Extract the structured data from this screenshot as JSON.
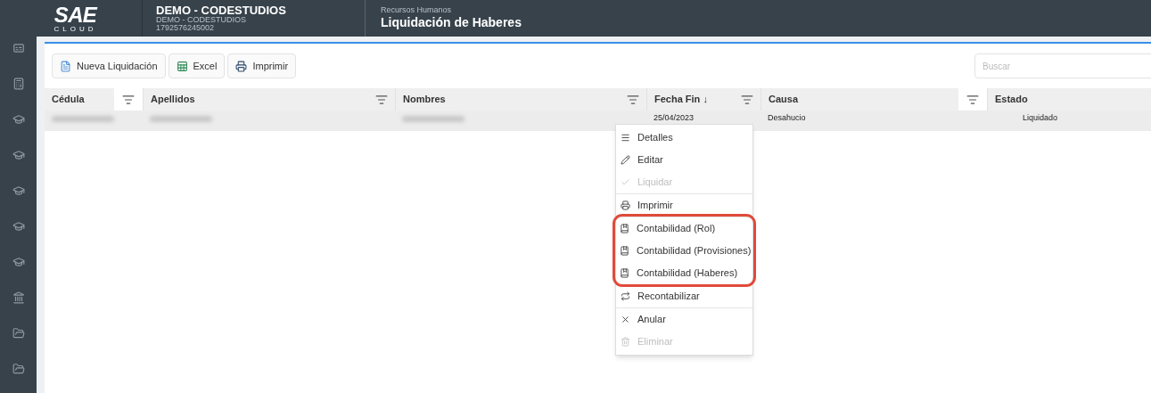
{
  "logo": {
    "mark": "SAE",
    "sub": "CLOUD"
  },
  "company": {
    "name": "DEMO - CODESTUDIOS",
    "subtitle": "DEMO - CODESTUDIOS",
    "ruc": "1792576245002"
  },
  "breadcrumb": {
    "module": "Recursos Humanos",
    "title": "Liquidación de Haberes"
  },
  "sidebar": {
    "items": [
      {
        "kind": "cc"
      },
      {
        "kind": "calculator"
      },
      {
        "kind": "school"
      },
      {
        "kind": "school"
      },
      {
        "kind": "school"
      },
      {
        "kind": "school"
      },
      {
        "kind": "school"
      },
      {
        "kind": "bank"
      },
      {
        "kind": "folder"
      },
      {
        "kind": "folder"
      }
    ]
  },
  "toolbar": [
    {
      "kind": "new",
      "label": "Nueva Liquidación"
    },
    {
      "kind": "excel",
      "label": "Excel"
    },
    {
      "kind": "print",
      "label": "Imprimir"
    }
  ],
  "search": {
    "placeholder": "Buscar"
  },
  "table": {
    "columns": [
      {
        "label": "Cédula",
        "kind": "button"
      },
      {
        "label": "Apellidos",
        "kind": "icon"
      },
      {
        "label": "Nombres",
        "kind": "icon"
      },
      {
        "label": "Fecha Fin ↓",
        "kind": "icon"
      },
      {
        "label": "Causa",
        "kind": "button"
      },
      {
        "label": "Estado",
        "kind": "plain"
      }
    ],
    "rows": [
      {
        "cells": [
          {
            "kind": "blurred"
          },
          {
            "kind": "blurred"
          },
          {
            "kind": "blurred"
          },
          {
            "kind": "text",
            "text": "25/04/2023"
          },
          {
            "kind": "text",
            "text": "Desahucio"
          },
          {
            "kind": "text",
            "text": "Liquidado"
          }
        ]
      }
    ]
  },
  "context_menu": {
    "sections": [
      {
        "highlighted": false,
        "items": [
          {
            "kind": "list",
            "label": "Detalles",
            "disabled": false
          },
          {
            "kind": "pencil",
            "label": "Editar",
            "disabled": false
          },
          {
            "kind": "check",
            "label": "Liquidar",
            "disabled": true
          }
        ]
      },
      {
        "highlighted": false,
        "items": [
          {
            "kind": "print",
            "label": "Imprimir",
            "disabled": false
          }
        ]
      },
      {
        "highlighted": true,
        "items": [
          {
            "kind": "book",
            "label": "Contabilidad (Rol)",
            "disabled": false
          },
          {
            "kind": "book",
            "label": "Contabilidad (Provisiones)",
            "disabled": false
          },
          {
            "kind": "book",
            "label": "Contabilidad (Haberes)",
            "disabled": false
          }
        ]
      },
      {
        "highlighted": false,
        "items": [
          {
            "kind": "repeat",
            "label": "Recontabilizar",
            "disabled": false
          }
        ]
      },
      {
        "highlighted": false,
        "items": [
          {
            "kind": "x",
            "label": "Anular",
            "disabled": false
          },
          {
            "kind": "trash",
            "label": "Eliminar",
            "disabled": true
          }
        ]
      }
    ]
  }
}
